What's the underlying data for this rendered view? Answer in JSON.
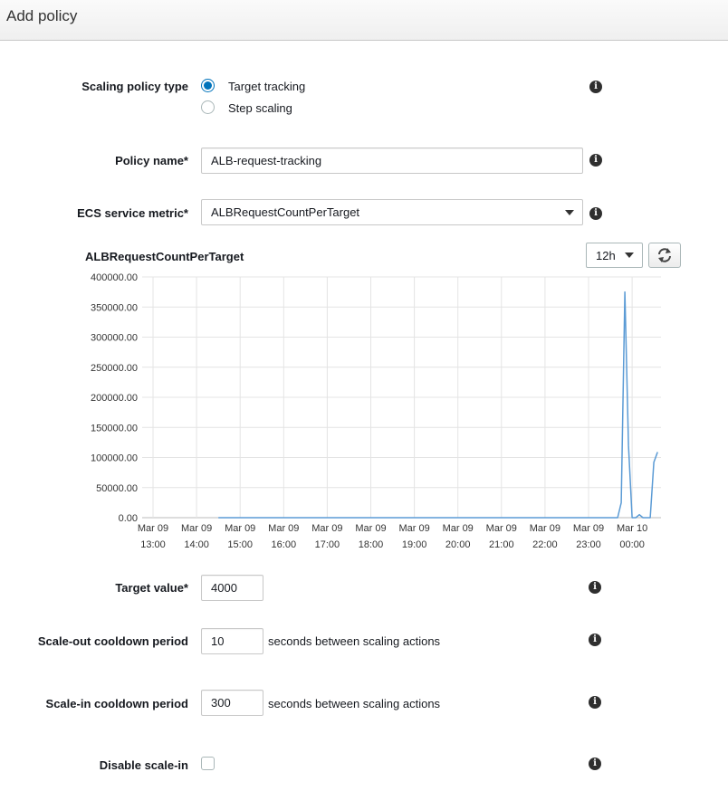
{
  "header": {
    "title": "Add policy"
  },
  "scaling_policy_type": {
    "label": "Scaling policy type",
    "options": [
      {
        "label": "Target tracking",
        "selected": true
      },
      {
        "label": "Step scaling",
        "selected": false
      }
    ]
  },
  "policy_name": {
    "label": "Policy name*",
    "value": "ALB-request-tracking"
  },
  "service_metric": {
    "label": "ECS service metric*",
    "value": "ALBRequestCountPerTarget"
  },
  "period_select": {
    "value": "12h"
  },
  "chart_data": {
    "type": "line",
    "title": "ALBRequestCountPerTarget",
    "ylim": [
      0,
      400000
    ],
    "y_ticks": [
      "400000.00",
      "350000.00",
      "300000.00",
      "250000.00",
      "200000.00",
      "150000.00",
      "100000.00",
      "50000.00",
      "0.00"
    ],
    "x_ticks": [
      [
        "Mar 09",
        "13:00"
      ],
      [
        "Mar 09",
        "14:00"
      ],
      [
        "Mar 09",
        "15:00"
      ],
      [
        "Mar 09",
        "16:00"
      ],
      [
        "Mar 09",
        "17:00"
      ],
      [
        "Mar 09",
        "18:00"
      ],
      [
        "Mar 09",
        "19:00"
      ],
      [
        "Mar 09",
        "20:00"
      ],
      [
        "Mar 09",
        "21:00"
      ],
      [
        "Mar 09",
        "22:00"
      ],
      [
        "Mar 09",
        "23:00"
      ],
      [
        "Mar 10",
        "00:00"
      ]
    ],
    "grid": true,
    "line_color": "#5b9bd5",
    "series": [
      {
        "x": [
          "Mar 09 14:30",
          "Mar 09 23:38",
          "Mar 09 23:40",
          "Mar 09 23:45",
          "Mar 09 23:50",
          "Mar 09 23:55",
          "Mar 10 00:00",
          "Mar 10 00:05",
          "Mar 10 00:10",
          "Mar 10 00:15",
          "Mar 10 00:20",
          "Mar 10 00:25",
          "Mar 10 00:30",
          "Mar 10 00:35"
        ],
        "y": [
          0,
          0,
          0,
          25000,
          375000,
          120000,
          0,
          0,
          5000,
          0,
          0,
          0,
          92000,
          109000
        ]
      }
    ]
  },
  "target_value": {
    "label": "Target value*",
    "value": "4000"
  },
  "scale_out": {
    "label": "Scale-out cooldown period",
    "value": "10",
    "suffix": "seconds between scaling actions"
  },
  "scale_in": {
    "label": "Scale-in cooldown period",
    "value": "300",
    "suffix": "seconds between scaling actions"
  },
  "disable_scale_in": {
    "label": "Disable scale-in",
    "checked": false
  }
}
